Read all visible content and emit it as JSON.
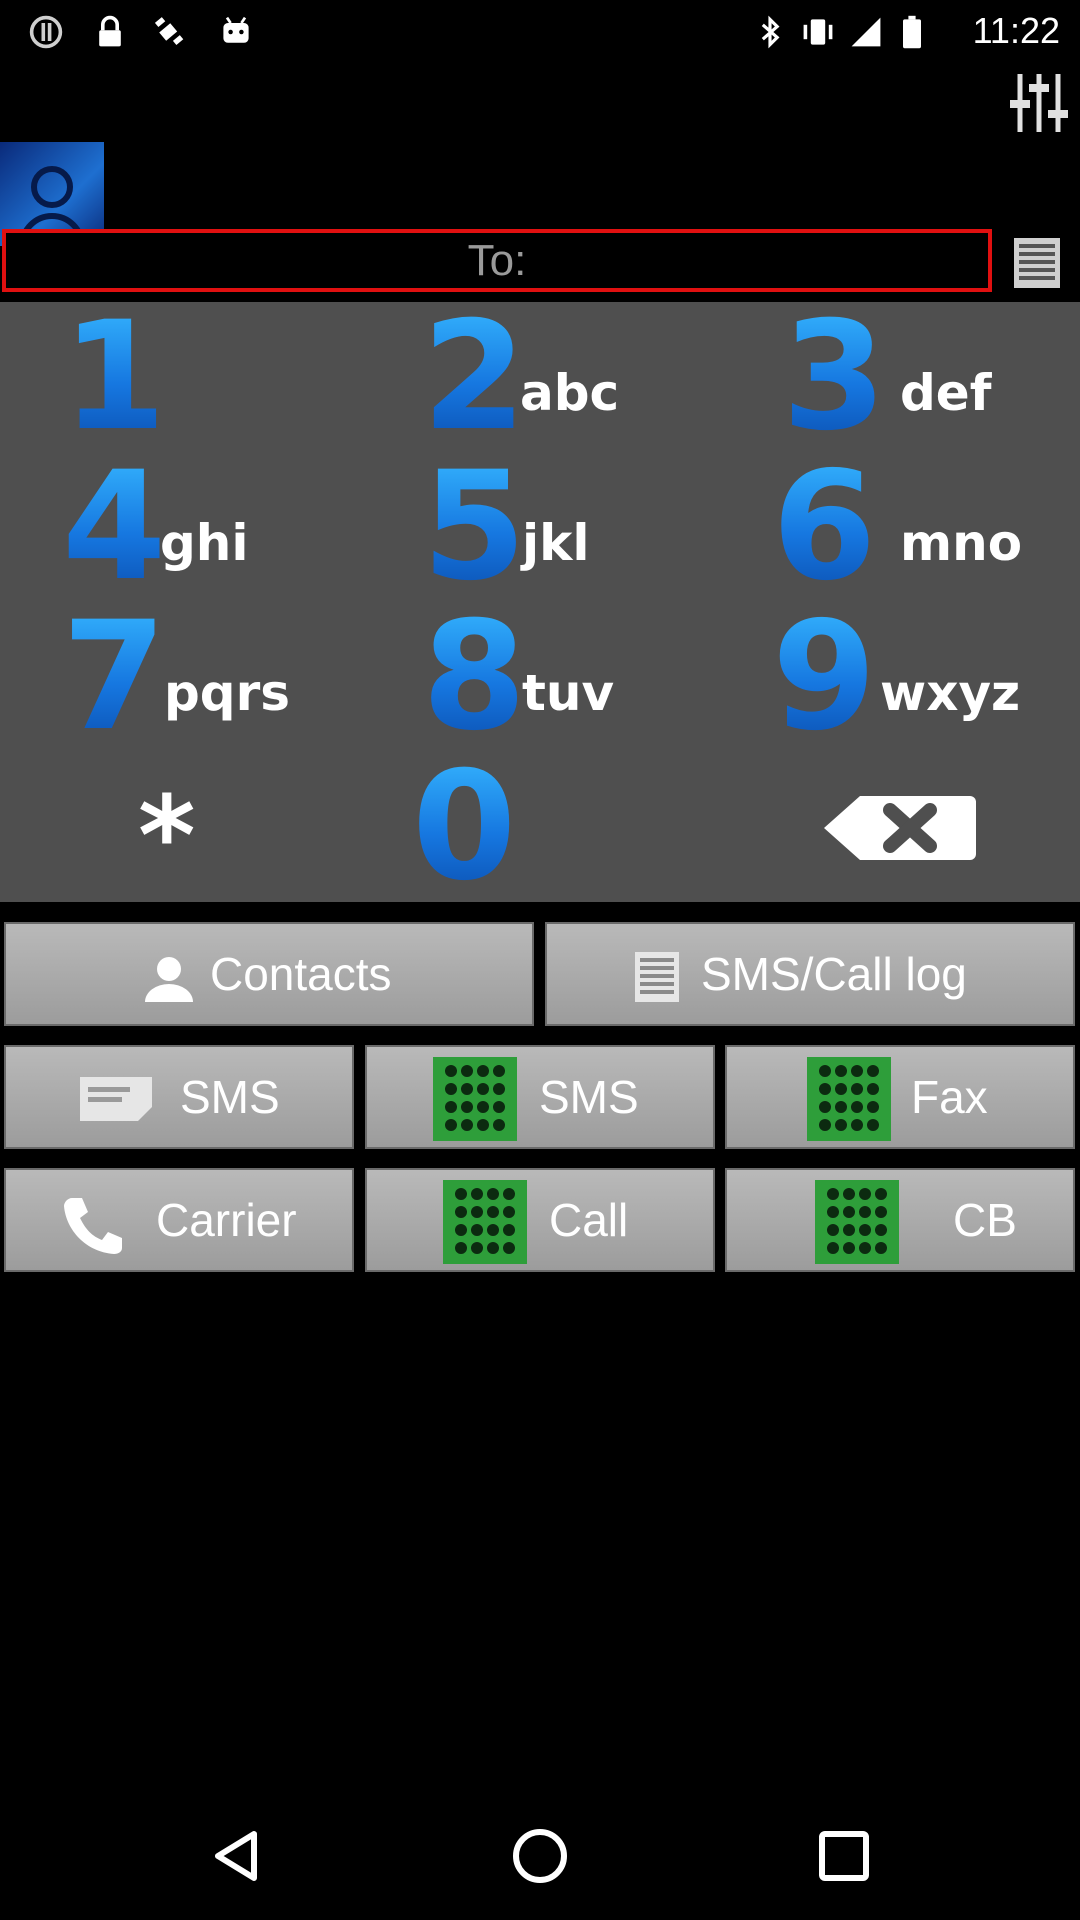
{
  "status_bar": {
    "time": "11:22",
    "left_icons": [
      "alert-icon",
      "lock-icon",
      "fake-gps-icon",
      "android-icon"
    ],
    "right_icons": [
      "bluetooth-icon",
      "vibrate-icon",
      "signal-icon",
      "battery-icon"
    ]
  },
  "header": {
    "to_label": "To:",
    "settings_icon": "sliders-icon",
    "log_icon": "list-icon"
  },
  "keypad": {
    "keys": [
      {
        "digit": "1",
        "letters": ""
      },
      {
        "digit": "2",
        "letters": "abc"
      },
      {
        "digit": "3",
        "letters": "def"
      },
      {
        "digit": "4",
        "letters": "ghi"
      },
      {
        "digit": "5",
        "letters": "jkl"
      },
      {
        "digit": "6",
        "letters": "mno"
      },
      {
        "digit": "7",
        "letters": "pqrs"
      },
      {
        "digit": "8",
        "letters": "tuv"
      },
      {
        "digit": "9",
        "letters": "wxyz"
      },
      {
        "digit": "*",
        "letters": ""
      },
      {
        "digit": "0",
        "letters": ""
      },
      {
        "digit": "",
        "letters": ""
      }
    ]
  },
  "actions": {
    "contacts": "Contacts",
    "sms_call_log": "SMS/Call log",
    "sms_native": "SMS",
    "sms_green": "SMS",
    "fax": "Fax",
    "carrier": "Carrier",
    "call": "Call",
    "cb": "CB"
  },
  "colors": {
    "keypad_bg": "#4f4f4f",
    "digit_blue": "#1677e0",
    "button_gray": "#a8a8a8",
    "to_border": "#e01010",
    "green_icon": "#2e9e3a"
  }
}
